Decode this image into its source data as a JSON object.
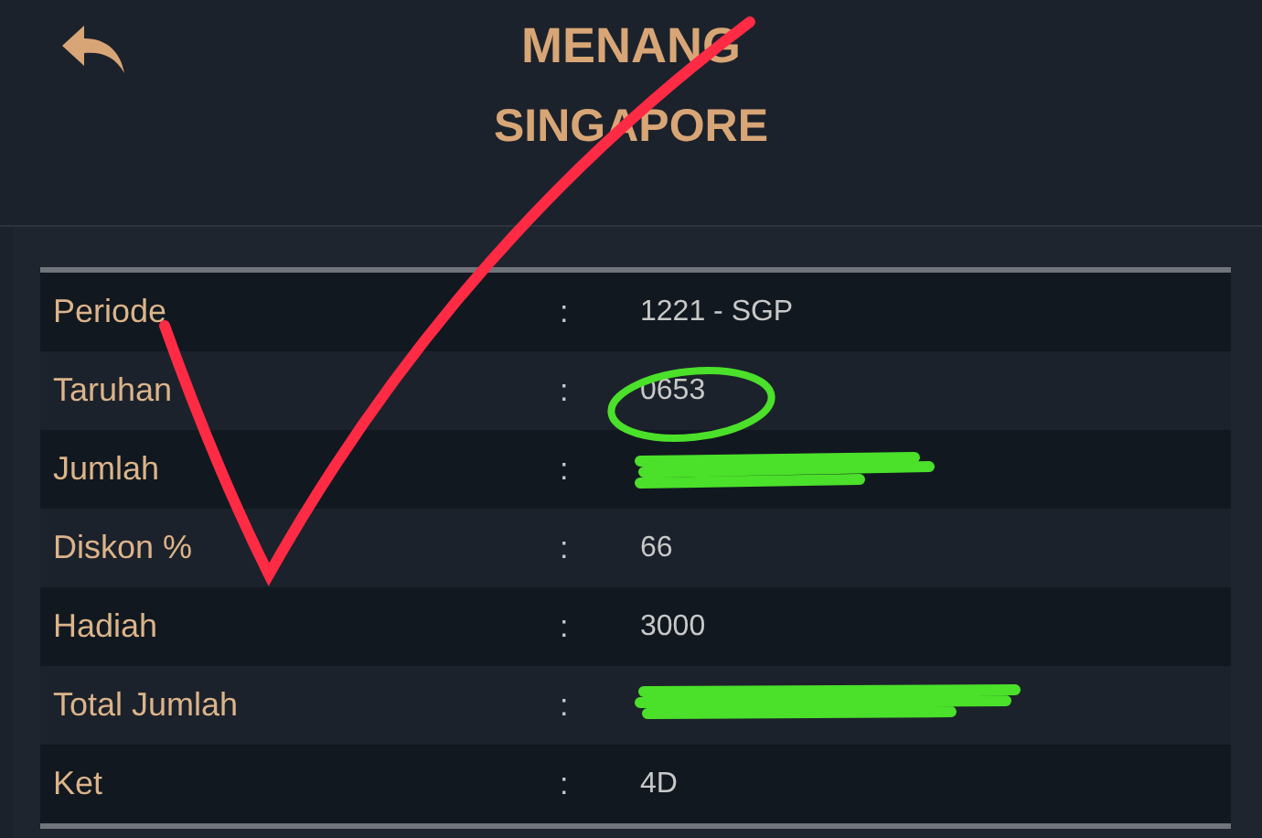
{
  "header": {
    "title": "MENANG",
    "subtitle": "SINGAPORE"
  },
  "rows": [
    {
      "label": "Periode",
      "separator": ":",
      "value": "1221 - SGP"
    },
    {
      "label": "Taruhan",
      "separator": ":",
      "value": "0653"
    },
    {
      "label": "Jumlah",
      "separator": ":"
    },
    {
      "label": "Diskon %",
      "separator": ":",
      "value": "66"
    },
    {
      "label": "Hadiah",
      "separator": ":",
      "value": "3000"
    },
    {
      "label": "Total Jumlah",
      "separator": ":"
    },
    {
      "label": "Ket",
      "separator": ":",
      "value": "4D"
    }
  ]
}
